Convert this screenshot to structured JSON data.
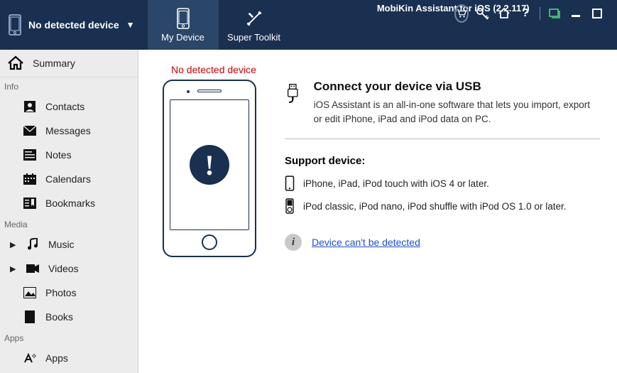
{
  "app_title": "MobiKin Assistant for iOS (2.2.117)",
  "topbar": {
    "device_label": "No detected device",
    "tabs": {
      "my_device": "My Device",
      "super_toolkit": "Super Toolkit"
    }
  },
  "sidebar": {
    "summary": "Summary",
    "groups": {
      "info": "Info",
      "media": "Media",
      "apps_hdr": "Apps"
    },
    "items": {
      "contacts": "Contacts",
      "messages": "Messages",
      "notes": "Notes",
      "calendars": "Calendars",
      "bookmarks": "Bookmarks",
      "music": "Music",
      "videos": "Videos",
      "photos": "Photos",
      "books": "Books",
      "apps": "Apps"
    }
  },
  "content": {
    "status": "No detected device",
    "connect_title": "Connect your device via USB",
    "connect_desc": "iOS Assistant is an all-in-one software that lets you import, export or edit iPhone, iPad and iPod data on PC.",
    "support_title": "Support device:",
    "support_line1": "iPhone, iPad, iPod touch with iOS 4 or later.",
    "support_line2": "iPod classic, iPod nano, iPod shuffle with iPod OS 1.0 or later.",
    "detect_link": "Device can't be detected"
  }
}
